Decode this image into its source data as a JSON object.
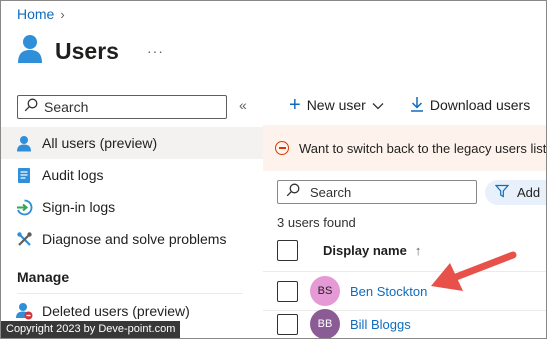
{
  "breadcrumb": {
    "home": "Home",
    "separator": "›"
  },
  "header": {
    "title": "Users",
    "more": "···",
    "icon": "user-icon"
  },
  "sidebar": {
    "search_placeholder": "Search",
    "collapse": "«",
    "items": [
      {
        "label": "All users (preview)",
        "icon": "user-icon",
        "active": true
      },
      {
        "label": "Audit logs",
        "icon": "document-icon"
      },
      {
        "label": "Sign-in logs",
        "icon": "sign-in-icon"
      },
      {
        "label": "Diagnose and solve problems",
        "icon": "wrench-icon"
      }
    ],
    "manage_heading": "Manage",
    "manage_items": [
      {
        "label": "Deleted users (preview)",
        "icon": "deleted-user-icon"
      }
    ]
  },
  "toolbar": {
    "new_user": "New user",
    "download_users": "Download users"
  },
  "banner": {
    "text": "Want to switch back to the legacy users list exp"
  },
  "user_list": {
    "search_placeholder": "Search",
    "filter_label": "Add",
    "count_text": "3 users found",
    "column_display_name": "Display name",
    "sort_indicator": "↑",
    "rows": [
      {
        "initials": "BS",
        "name": "Ben Stockton",
        "avatar_color": "#e59ad6"
      },
      {
        "initials": "BB",
        "name": "Bill Bloggs",
        "avatar_color": "#8b5b96"
      }
    ]
  },
  "colors": {
    "accent": "#0f6cbd",
    "annotation_arrow": "#e8504a",
    "banner_bg": "#fdf3ec",
    "warning": "#d83b01"
  },
  "watermark": "Copyright 2023 by Deve-point.com"
}
